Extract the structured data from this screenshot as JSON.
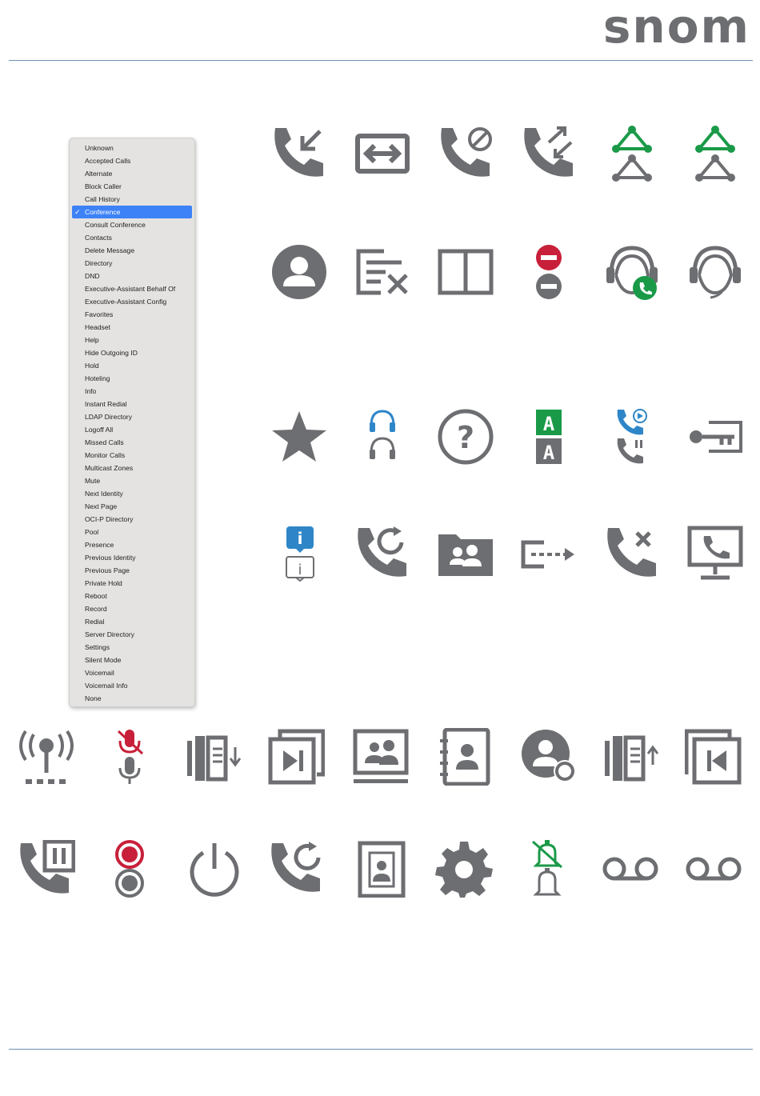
{
  "header": {
    "logo_text": "snom"
  },
  "menu": {
    "selected_index": 5,
    "check_mark": "✓",
    "items": [
      "Unknown",
      "Accepted Calls",
      "Alternate",
      "Block Caller",
      "Call History",
      "Conference",
      "Consult Conference",
      "Contacts",
      "Delete Message",
      "Directory",
      "DND",
      "Executive-Assistant Behalf Of",
      "Executive-Assistant Config",
      "Favorites",
      "Headset",
      "Help",
      "Hide Outgoing ID",
      "Hold",
      "Hoteling",
      "Info",
      "Instant Redial",
      "LDAP Directory",
      "Logoff All",
      "Missed Calls",
      "Monitor Calls",
      "Multicast Zones",
      "Mute",
      "Next Identity",
      "Next Page",
      "OCI-P Directory",
      "Pool",
      "Presence",
      "Previous Identity",
      "Previous Page",
      "Private Hold",
      "Reboot",
      "Record",
      "Redial",
      "Server Directory",
      "Settings",
      "Silent Mode",
      "Voicemail",
      "Voicemail Info",
      "None"
    ]
  },
  "colors": {
    "icon_gray": "#6d6e71",
    "green": "#1a9a48",
    "red": "#c8203a",
    "blue": "#2e86c8",
    "selection": "#3d82f7",
    "rule": "#6b8fb3"
  },
  "icons": [
    "accepted-calls-icon",
    "alternate-icon",
    "block-caller-icon",
    "call-history-icon",
    "conference-icon",
    "consult-conference-icon",
    "contacts-icon",
    "delete-message-icon",
    "directory-icon",
    "dnd-icon",
    "executive-assistant-behalf-icon",
    "executive-assistant-config-icon",
    "favorites-icon",
    "headset-icon",
    "help-icon",
    "hide-outgoing-id-icon",
    "hold-icon",
    "hoteling-icon",
    "info-icon",
    "instant-redial-icon",
    "ldap-directory-icon",
    "logoff-all-icon",
    "missed-calls-icon",
    "monitor-calls-icon",
    "multicast-zones-icon",
    "mute-icon",
    "next-identity-icon",
    "next-page-icon",
    "oci-p-directory-icon",
    "pool-icon",
    "presence-icon",
    "previous-identity-icon",
    "previous-page-icon",
    "private-hold-icon",
    "record-icon",
    "reboot-icon",
    "redial-icon",
    "server-directory-icon",
    "settings-icon",
    "silent-mode-icon",
    "voicemail-icon",
    "voicemail-info-icon"
  ]
}
